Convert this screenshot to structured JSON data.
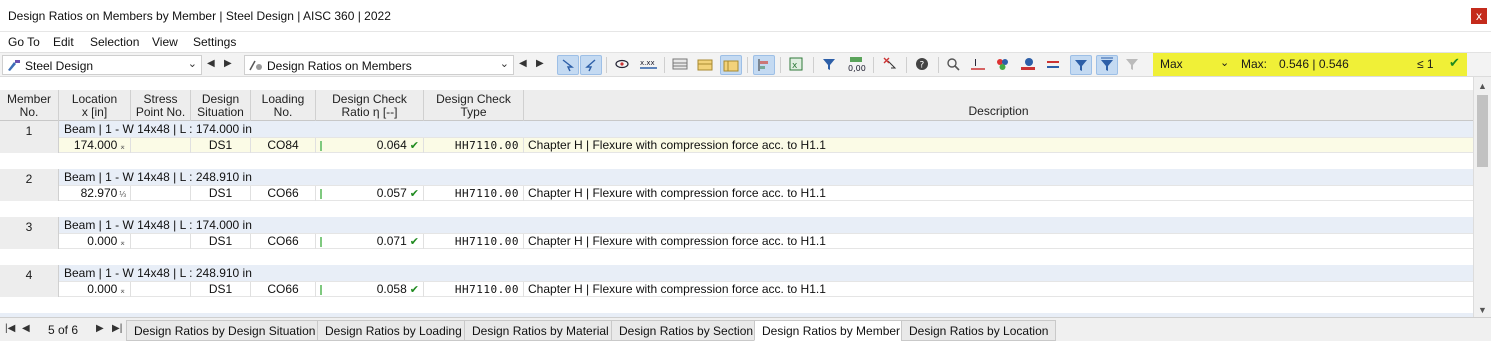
{
  "window": {
    "title": "Design Ratios on Members by Member | Steel Design | AISC 360 | 2022",
    "close_glyph": "x"
  },
  "menu": [
    "Go To",
    "Edit",
    "Selection",
    "View",
    "Settings"
  ],
  "toolbar": {
    "module": "Steel Design",
    "result_type": "Design Ratios on Members",
    "filter_mode": "Max",
    "max_label": "Max:",
    "max_value": "0.546 | 0.546",
    "limit": "≤ 1",
    "colors": {
      "highlight": "#f0f037",
      "active_button": "#c4daf2",
      "ok": "#1f8a1f"
    }
  },
  "columns": {
    "member_no": [
      "Member",
      "No."
    ],
    "location": [
      "Location",
      "x [in]"
    ],
    "stress_point": [
      "Stress",
      "Point No."
    ],
    "design_situation": [
      "Design",
      "Situation"
    ],
    "loading": [
      "Loading",
      "No."
    ],
    "ratio": [
      "Design Check",
      "Ratio η [--]"
    ],
    "type": [
      "Design Check",
      "Type"
    ],
    "description": "Description"
  },
  "groups": [
    {
      "no": "1",
      "header": "Beam | 1 - W 14x48 | L : 174.000 in",
      "location": "174.000",
      "loc_symbol": "⌅",
      "situation": "DS1",
      "loading": "CO84",
      "ratio": "0.064",
      "type": "HH7110.00",
      "description": "Chapter H | Flexure with compression force acc. to H1.1",
      "selected": true
    },
    {
      "no": "2",
      "header": "Beam | 1 - W 14x48 | L : 248.910 in",
      "location": "82.970",
      "loc_symbol": "⅓",
      "situation": "DS1",
      "loading": "CO66",
      "ratio": "0.057",
      "type": "HH7110.00",
      "description": "Chapter H | Flexure with compression force acc. to H1.1",
      "selected": false
    },
    {
      "no": "3",
      "header": "Beam | 1 - W 14x48 | L : 174.000 in",
      "location": "0.000",
      "loc_symbol": "⌅",
      "situation": "DS1",
      "loading": "CO66",
      "ratio": "0.071",
      "type": "HH7110.00",
      "description": "Chapter H | Flexure with compression force acc. to H1.1",
      "selected": false
    },
    {
      "no": "4",
      "header": "Beam | 1 - W 14x48 | L : 248.910 in",
      "location": "0.000",
      "loc_symbol": "⌅",
      "situation": "DS1",
      "loading": "CO66",
      "ratio": "0.058",
      "type": "HH7110.00",
      "description": "Chapter H | Flexure with compression force acc. to H1.1",
      "selected": false
    }
  ],
  "pagination": {
    "info": "5 of 6"
  },
  "tabs": [
    {
      "label": "Design Ratios by Design Situation",
      "active": false
    },
    {
      "label": "Design Ratios by Loading",
      "active": false
    },
    {
      "label": "Design Ratios by Material",
      "active": false
    },
    {
      "label": "Design Ratios by Section",
      "active": false
    },
    {
      "label": "Design Ratios by Member",
      "active": true
    },
    {
      "label": "Design Ratios by Location",
      "active": false
    }
  ]
}
